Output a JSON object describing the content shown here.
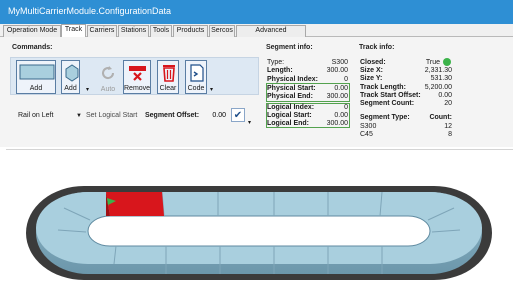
{
  "window": {
    "title": "MyMultiCarrierModule.ConfigurationData"
  },
  "tabs": [
    {
      "label": "Operation Mode"
    },
    {
      "label": "Track"
    },
    {
      "label": "Carriers"
    },
    {
      "label": "Stations"
    },
    {
      "label": "Tools"
    },
    {
      "label": "Products"
    },
    {
      "label": "Sercos"
    },
    {
      "label": "Advanced Parameters"
    }
  ],
  "active_tab": "Track",
  "commands": {
    "header": "Commands:",
    "add_segment": "Add",
    "add_curve": "Add",
    "auto": "Auto",
    "remove": "Remove",
    "clear": "Clear",
    "code": "Code",
    "rail_select": "Rail on Left",
    "set_logical_start": "Set Logical Start",
    "segment_offset_label": "Segment Offset:",
    "segment_offset_value": "0.00"
  },
  "segment_info": {
    "header": "Segment info:",
    "type_label": "Type:",
    "type_value": "S300",
    "length_label": "Length:",
    "length_value": "300.00",
    "physical_index_label": "Physical Index:",
    "physical_index_value": "0",
    "physical_start_label": "Physical Start:",
    "physical_start_value": "0.00",
    "physical_end_label": "Physical End:",
    "physical_end_value": "300.00",
    "logical_index_label": "Logical Index:",
    "logical_index_value": "0",
    "logical_start_label": "Logical Start:",
    "logical_start_value": "0.00",
    "logical_end_label": "Logical End:",
    "logical_end_value": "300.00"
  },
  "track_info": {
    "header": "Track info:",
    "closed_label": "Closed:",
    "closed_value": "True",
    "size_x_label": "Size X:",
    "size_x_value": "2,331.30",
    "size_y_label": "Size Y:",
    "size_y_value": "531.30",
    "track_length_label": "Track Length:",
    "track_length_value": "5,200.00",
    "track_start_offset_label": "Track Start Offset:",
    "track_start_offset_value": "0.00",
    "segment_count_label": "Segment Count:",
    "segment_count_value": "20",
    "segment_type_header": "Segment Type:",
    "count_header": "Count:",
    "segment_types": [
      {
        "type": "S300",
        "count": "12"
      },
      {
        "type": "C45",
        "count": "8"
      }
    ]
  },
  "colors": {
    "titlebar": "#2e8fd4",
    "track_top": "#a9cfde",
    "selected_segment": "#d8161c",
    "closed_indicator": "#3cb34a"
  },
  "icons": {
    "add_segment": "segment-icon",
    "add_curve": "curve-segment-icon",
    "auto": "refresh-icon",
    "remove": "remove-segment-icon",
    "clear": "trash-icon",
    "code": "code-edit-icon",
    "confirm": "checkmark-icon"
  }
}
